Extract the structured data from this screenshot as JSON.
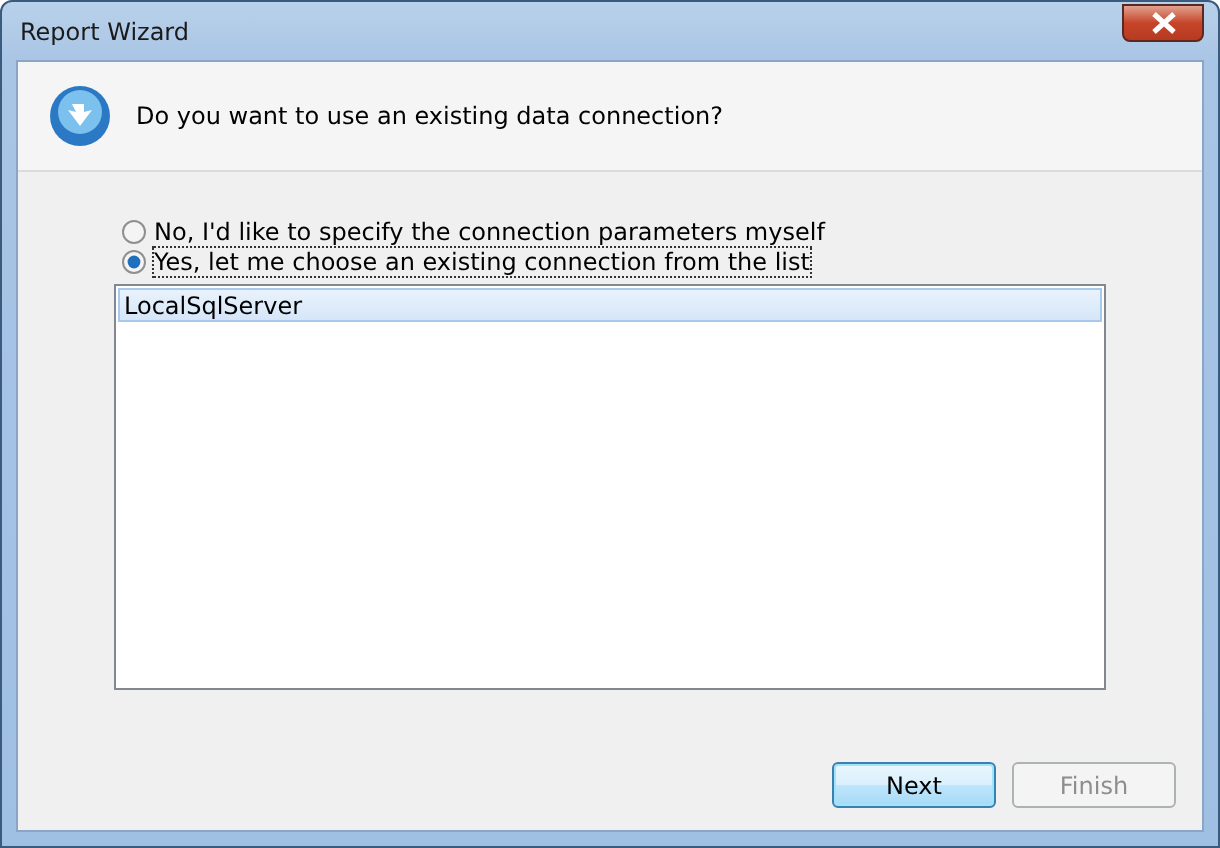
{
  "window": {
    "title": "Report Wizard"
  },
  "header": {
    "question": "Do you want to use an existing data connection?"
  },
  "options": [
    {
      "label": "No, I'd like to specify the connection parameters myself",
      "selected": false
    },
    {
      "label": "Yes, let me choose an existing connection from the list",
      "selected": true
    }
  ],
  "connections": [
    {
      "name": "LocalSqlServer",
      "selected": true
    }
  ],
  "buttons": [
    {
      "label": "Next",
      "disabled": false,
      "default": true
    },
    {
      "label": "Finish",
      "disabled": true,
      "default": false
    }
  ]
}
